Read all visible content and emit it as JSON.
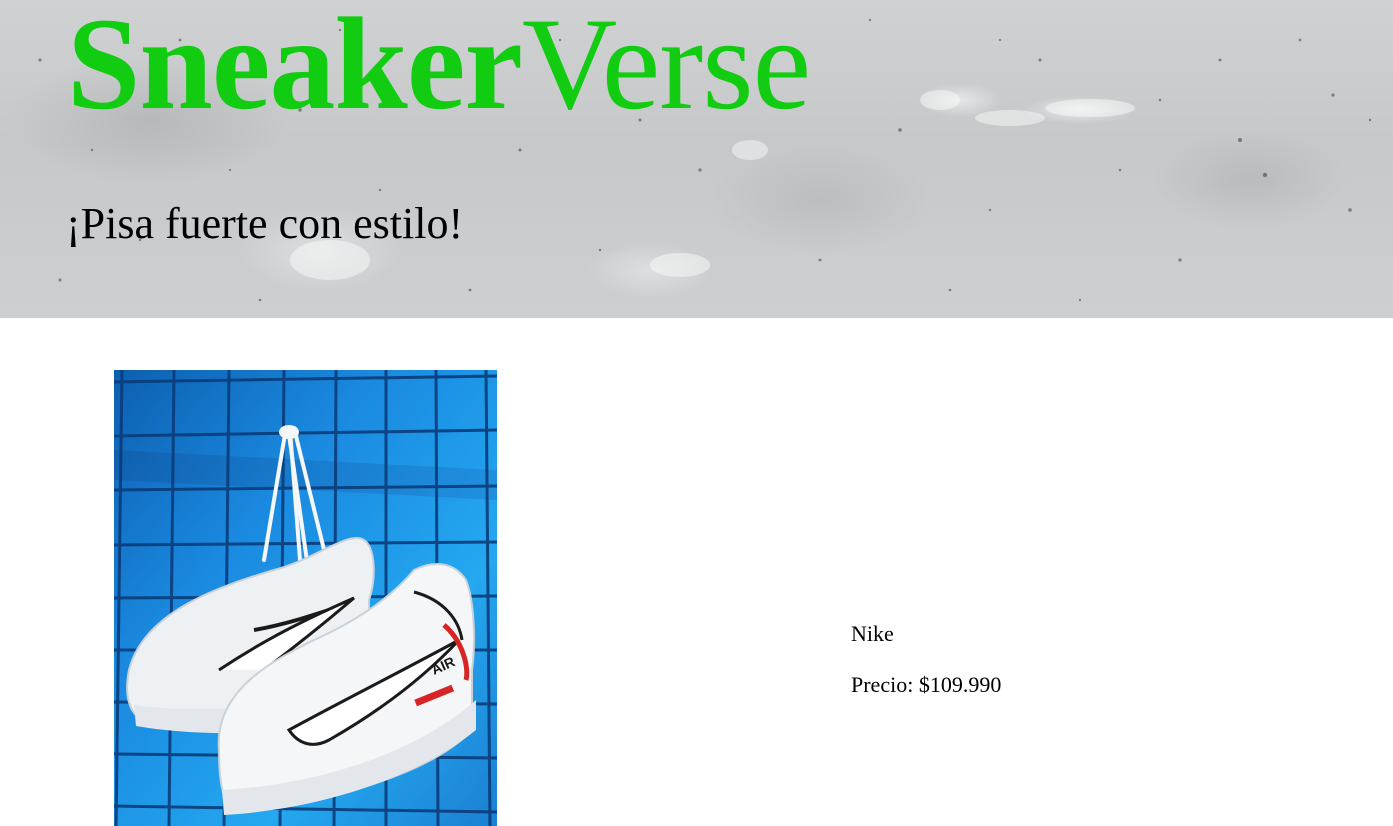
{
  "header": {
    "brand_part1": "Sneaker",
    "brand_part2": "Verse",
    "tagline": "¡Pisa fuerte con estilo!"
  },
  "product": {
    "name": "Nike",
    "price_text": "Precio: $109.990",
    "image_icon": "sneakers-photo"
  },
  "colors": {
    "brand_green": "#12cc12",
    "text": "#000000",
    "concrete": "#c9cbcc",
    "photo_blue": "#1c8ee0"
  }
}
